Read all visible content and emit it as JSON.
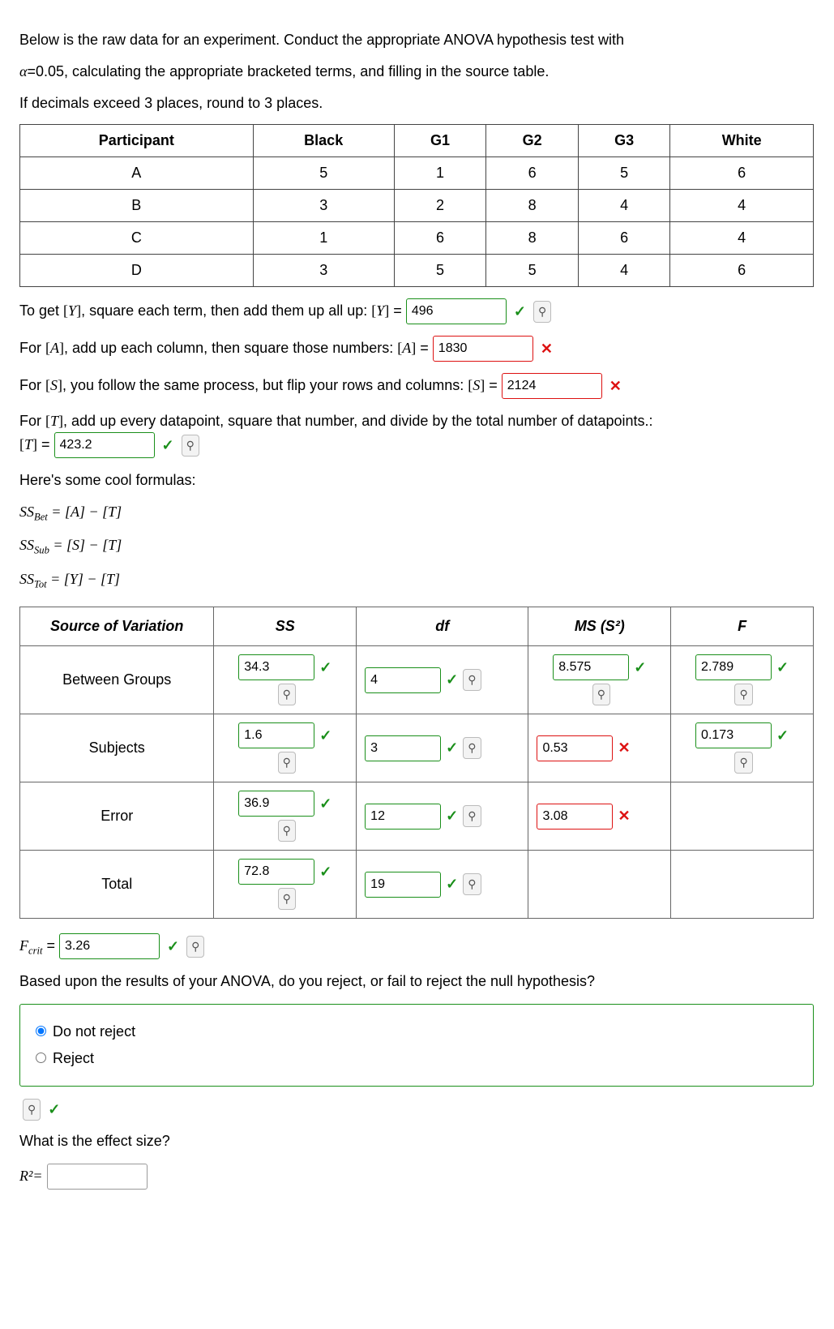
{
  "intro1": "Below is the raw data for an experiment. Conduct the appropriate ANOVA hypothesis test with",
  "intro2": "α=0.05, calculating the appropriate bracketed terms, and filling in the source table.",
  "intro3": "If decimals exceed 3 places, round to 3 places.",
  "dataTable": {
    "headers": [
      "Participant",
      "Black",
      "G1",
      "G2",
      "G3",
      "White"
    ],
    "rows": [
      [
        "A",
        "5",
        "1",
        "6",
        "5",
        "6"
      ],
      [
        "B",
        "3",
        "2",
        "8",
        "4",
        "4"
      ],
      [
        "C",
        "1",
        "6",
        "8",
        "6",
        "4"
      ],
      [
        "D",
        "3",
        "5",
        "5",
        "4",
        "6"
      ]
    ]
  },
  "qY_a": "To get ",
  "qY_b": ", square each term, then add them up all up: ",
  "qY_val": "496",
  "qA_a": "For ",
  "qA_b": ", add up each column, then square those numbers: ",
  "qA_val": "1830",
  "qS_a": "For ",
  "qS_b": ", you follow the same process, but flip your rows and columns: ",
  "qS_val": "2124",
  "qT_a": "For ",
  "qT_b": ", add up every datapoint, square that number, and divide by the total number of datapoints.:",
  "qT_val": "423.2",
  "formulaHeading": "Here's some cool formulas:",
  "f1_lhs": "SS",
  "f1_sub": "Bet",
  "f1_rhs": " = [A] − [T]",
  "f2_lhs": "SS",
  "f2_sub": "Sub",
  "f2_rhs": " = [S] − [T]",
  "f3_lhs": "SS",
  "f3_sub": "Tot",
  "f3_rhs": " = [Y] − [T]",
  "src": {
    "h": [
      "Source of Variation",
      "SS",
      "df",
      "MS (S²)",
      "F"
    ],
    "r1": {
      "name": "Between Groups",
      "ss": "34.3",
      "df": "4",
      "ms": "8.575",
      "f": "2.789"
    },
    "r2": {
      "name": "Subjects",
      "ss": "1.6",
      "df": "3",
      "ms": "0.53",
      "f": "0.173"
    },
    "r3": {
      "name": "Error",
      "ss": "36.9",
      "df": "12",
      "ms": "3.08"
    },
    "r4": {
      "name": "Total",
      "ss": "72.8",
      "df": "19"
    }
  },
  "fcrit_label": "F",
  "fcrit_sub": "crit",
  "equals": " = ",
  "fcrit_val": "3.26",
  "decisionQ": "Based upon the results of your ANOVA, do you reject, or fail to reject the null hypothesis?",
  "opt1": "Do not reject",
  "opt2": "Reject",
  "effectQ": "What is the effect size?",
  "r2label": "R²="
}
